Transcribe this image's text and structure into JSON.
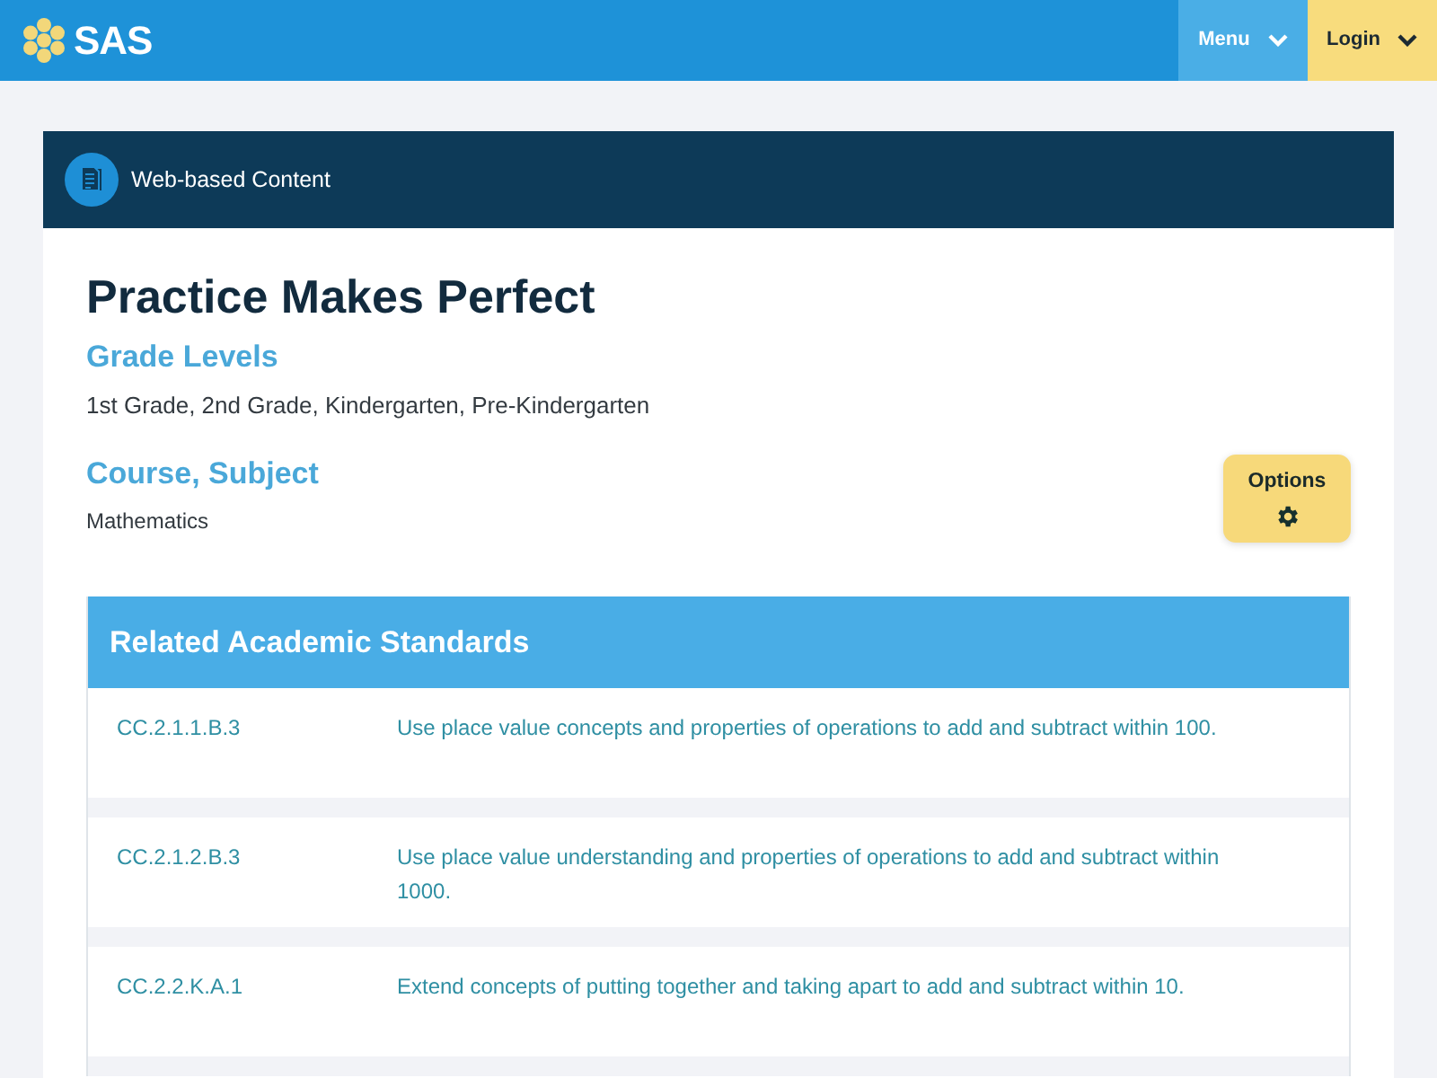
{
  "header": {
    "logo_text": "SAS",
    "nav_buttons": [
      {
        "label": "Menu",
        "kind": "menu"
      },
      {
        "label": "Login",
        "kind": "login"
      }
    ]
  },
  "resource": {
    "type_label": "Web-based Content",
    "title": "Practice Makes Perfect",
    "sections": [
      {
        "heading": "Grade Levels",
        "text": "1st Grade, 2nd Grade, Kindergarten, Pre-Kindergarten"
      },
      {
        "heading": "Course, Subject",
        "text": "Mathematics"
      }
    ],
    "options_button": "Options"
  },
  "standards": {
    "heading": "Related Academic Standards",
    "rows": [
      {
        "code": "CC.2.1.1.B.3",
        "description": "Use place value concepts and properties of operations to add and subtract within 100."
      },
      {
        "code": "CC.2.1.2.B.3",
        "description": "Use place value understanding and properties of operations to add and subtract within 1000."
      },
      {
        "code": "CC.2.2.K.A.1",
        "description": "Extend concepts of putting together and taking apart to add and subtract within 10."
      }
    ]
  }
}
